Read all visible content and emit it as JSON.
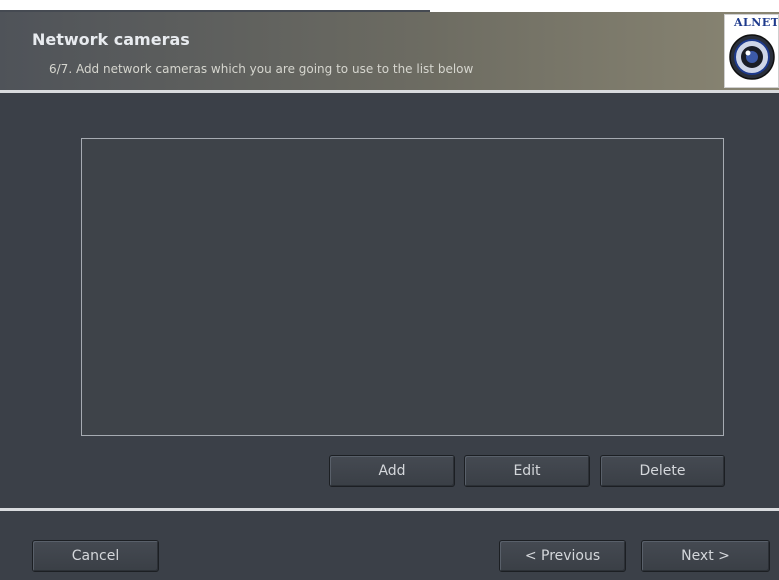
{
  "header": {
    "title": "Network cameras",
    "subtitle": "6/7. Add network cameras which you are going to use to the list below",
    "logo_text": "ALNET",
    "logo_icon": "camera-lens-icon"
  },
  "camera_list": {
    "items": []
  },
  "list_actions": {
    "add_label": "Add",
    "edit_label": "Edit",
    "delete_label": "Delete"
  },
  "footer": {
    "cancel_label": "Cancel",
    "previous_label": "< Previous",
    "next_label": "Next >"
  },
  "colors": {
    "background": "#3b4048",
    "header_gradient_end": "#8a8673",
    "text": "#d4d7db",
    "logo_blue": "#1e3a8c"
  }
}
